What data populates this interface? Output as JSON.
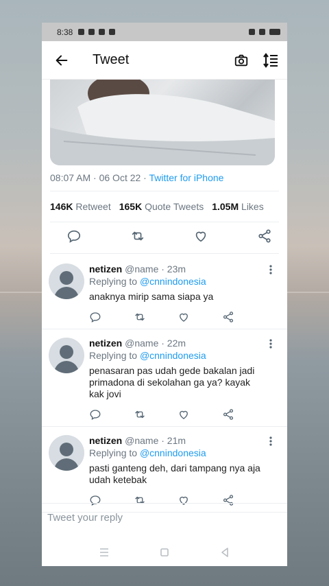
{
  "status_bar": {
    "time": "8:38"
  },
  "app_bar": {
    "title": "Tweet"
  },
  "tweet": {
    "timestamp": "08:07 AM · 06 Oct 22 · ",
    "source": "Twitter for iPhone",
    "stats": [
      {
        "count": "146K",
        "label": "Retweet"
      },
      {
        "count": "165K",
        "label": "Quote Tweets"
      },
      {
        "count": "1.05M",
        "label": "Likes"
      }
    ]
  },
  "replies": [
    {
      "name": "netizen",
      "handle_time": "@name · 23m",
      "replying_prefix": "Replying to ",
      "replying_handle": "@cnnindonesia",
      "text": "anaknya mirip sama siapa ya"
    },
    {
      "name": "netizen",
      "handle_time": "@name · 22m",
      "replying_prefix": "Replying to ",
      "replying_handle": "@cnnindonesia",
      "text": "penasaran pas udah gede bakalan jadi primadona di sekolahan ga ya? kayak kak jovi"
    },
    {
      "name": "netizen",
      "handle_time": "@name · 21m",
      "replying_prefix": "Replying to ",
      "replying_handle": "@cnnindonesia",
      "text": "pasti ganteng deh, dari tampang nya aja udah ketebak"
    }
  ],
  "compose": {
    "placeholder": "Tweet your reply"
  },
  "colors": {
    "accent": "#1d9bf0",
    "muted": "#6b7680"
  }
}
